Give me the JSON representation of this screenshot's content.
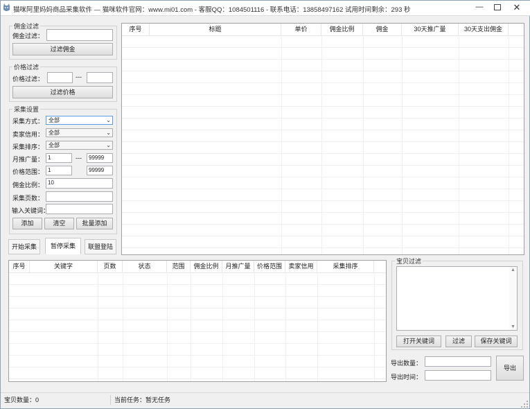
{
  "window": {
    "title": "猫咪阿里妈妈商品采集软件 — 猫咪软件官网：www.mi01.com - 客服QQ：1084501116 - 联系电话：13858497162  试用时间剩余：293 秒",
    "minimize_label": "—",
    "close_label": "✕"
  },
  "commission_filter": {
    "legend": "佣金过滤",
    "label": "佣金过滤：",
    "value": "",
    "button": "过滤佣金"
  },
  "price_filter": {
    "legend": "价格过滤",
    "label": "价格过滤：",
    "min": "",
    "separator": "---",
    "max": "",
    "button": "过滤价格"
  },
  "collect_settings": {
    "legend": "采集设置",
    "method_label": "采集方式：",
    "method_value": "全部",
    "seller_credit_label": "卖家信用：",
    "seller_credit_value": "全部",
    "sort_label": "采集排序：",
    "sort_value": "全部",
    "monthly_promo_label": "月推广量：",
    "monthly_promo_min": "1",
    "range_separator": "---",
    "monthly_promo_max": "99999",
    "price_range_label": "价格范围：",
    "price_min": "1",
    "price_max": "99999",
    "commission_ratio_label": "佣金比例：",
    "commission_ratio_value": "10",
    "pages_label": "采集页数：",
    "pages_value": "",
    "keyword_label": "输入关键词：",
    "keyword_value": "",
    "add_button": "添加",
    "clear_button": "清空",
    "batch_add_button": "批量添加"
  },
  "tabs": [
    "开始采集",
    "暂停采集",
    "联盟登陆"
  ],
  "results_table": {
    "columns": [
      "序号",
      "标题",
      "单价",
      "佣金比例",
      "佣金",
      "30天推广量",
      "30天支出佣金"
    ]
  },
  "keyword_table": {
    "columns": [
      "序号",
      "关键字",
      "页数",
      "状态",
      "范围",
      "佣金比例",
      "月推广量",
      "价格范围",
      "卖家信用",
      "采集排序"
    ]
  },
  "item_filter": {
    "legend": "宝贝过滤",
    "text": "",
    "open_keywords_button": "打开关键词",
    "filter_button": "过滤",
    "save_keywords_button": "保存关键词"
  },
  "export": {
    "qty_label": "导出数量：",
    "qty_value": "",
    "time_label": "导出时间：",
    "time_value": "",
    "button": "导出"
  },
  "status": {
    "count_label": "宝贝数量：",
    "count_value": "0",
    "task_label": "当前任务：",
    "task_value": "暂无任务"
  }
}
